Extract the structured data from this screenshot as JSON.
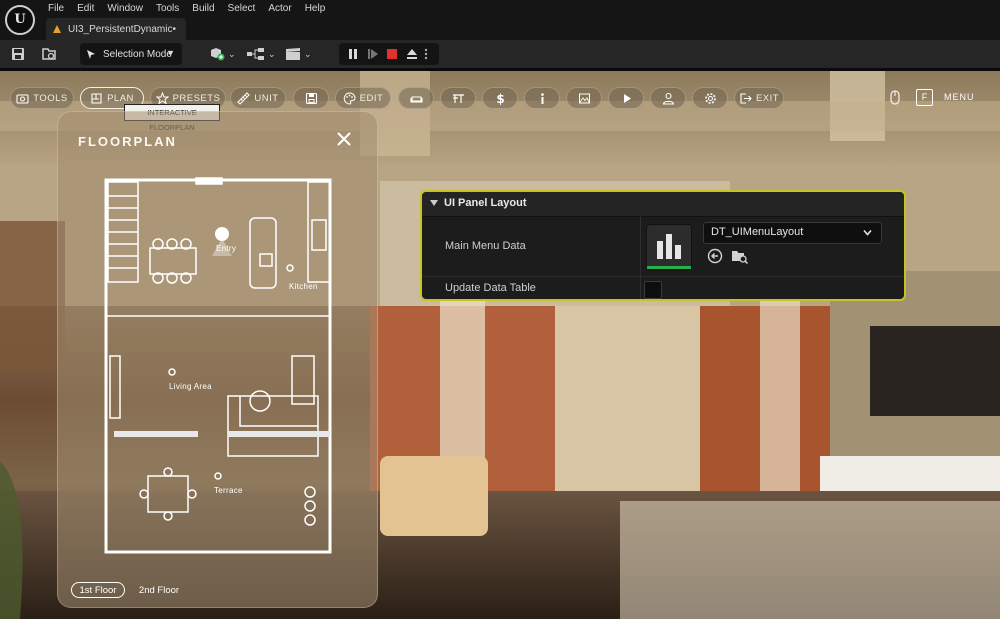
{
  "menubar": {
    "items": [
      "File",
      "Edit",
      "Window",
      "Tools",
      "Build",
      "Select",
      "Actor",
      "Help"
    ],
    "document_tab": "UI3_PersistentDynamic•"
  },
  "toolbar": {
    "mode_label": "Selection Mode"
  },
  "viewport_toolbar": {
    "items": [
      {
        "id": "tools",
        "label": "TOOLS",
        "icon": "camera-icon"
      },
      {
        "id": "plan",
        "label": "PLAN",
        "icon": "floorplan-icon",
        "active": true
      },
      {
        "id": "presets",
        "label": "PRESETS",
        "icon": "star-icon"
      },
      {
        "id": "unit",
        "label": "UNIT",
        "icon": "ruler-icon"
      },
      {
        "id": "save",
        "label": "",
        "icon": "floppy-icon"
      },
      {
        "id": "edit",
        "label": "EDIT",
        "icon": "palette-icon"
      },
      {
        "id": "sofa",
        "label": "",
        "icon": "sofa-icon"
      },
      {
        "id": "measure",
        "label": "",
        "icon": "beam-icon"
      },
      {
        "id": "price",
        "label": "",
        "icon": "dollar-icon"
      },
      {
        "id": "info",
        "label": "",
        "icon": "info-icon"
      },
      {
        "id": "gallery",
        "label": "",
        "icon": "image-icon"
      },
      {
        "id": "play",
        "label": "",
        "icon": "play-icon"
      },
      {
        "id": "user",
        "label": "",
        "icon": "user-icon"
      },
      {
        "id": "settings",
        "label": "",
        "icon": "gear-icon"
      },
      {
        "id": "exit",
        "label": "EXIT",
        "icon": "exit-icon"
      }
    ],
    "tooltip": "INTERACTIVE FLOORPLAN",
    "right_key": "F",
    "menu_label": "MENU"
  },
  "floorplan": {
    "title": "FLOORPLAN",
    "rooms": [
      "Entry",
      "Kitchen",
      "Living Area",
      "Terrace"
    ],
    "floors": [
      {
        "label": "1st Floor",
        "active": true
      },
      {
        "label": "2nd Floor",
        "active": false
      }
    ]
  },
  "ui_panel": {
    "title": "UI Panel Layout",
    "row1_label": "Main Menu Data",
    "asset_value": "DT_UIMenuLayout",
    "row2_label": "Update Data Table"
  },
  "colors": {
    "panel_border": "#c7c421",
    "asset_bar": "#24b24b",
    "stop_red": "#e0322d"
  }
}
